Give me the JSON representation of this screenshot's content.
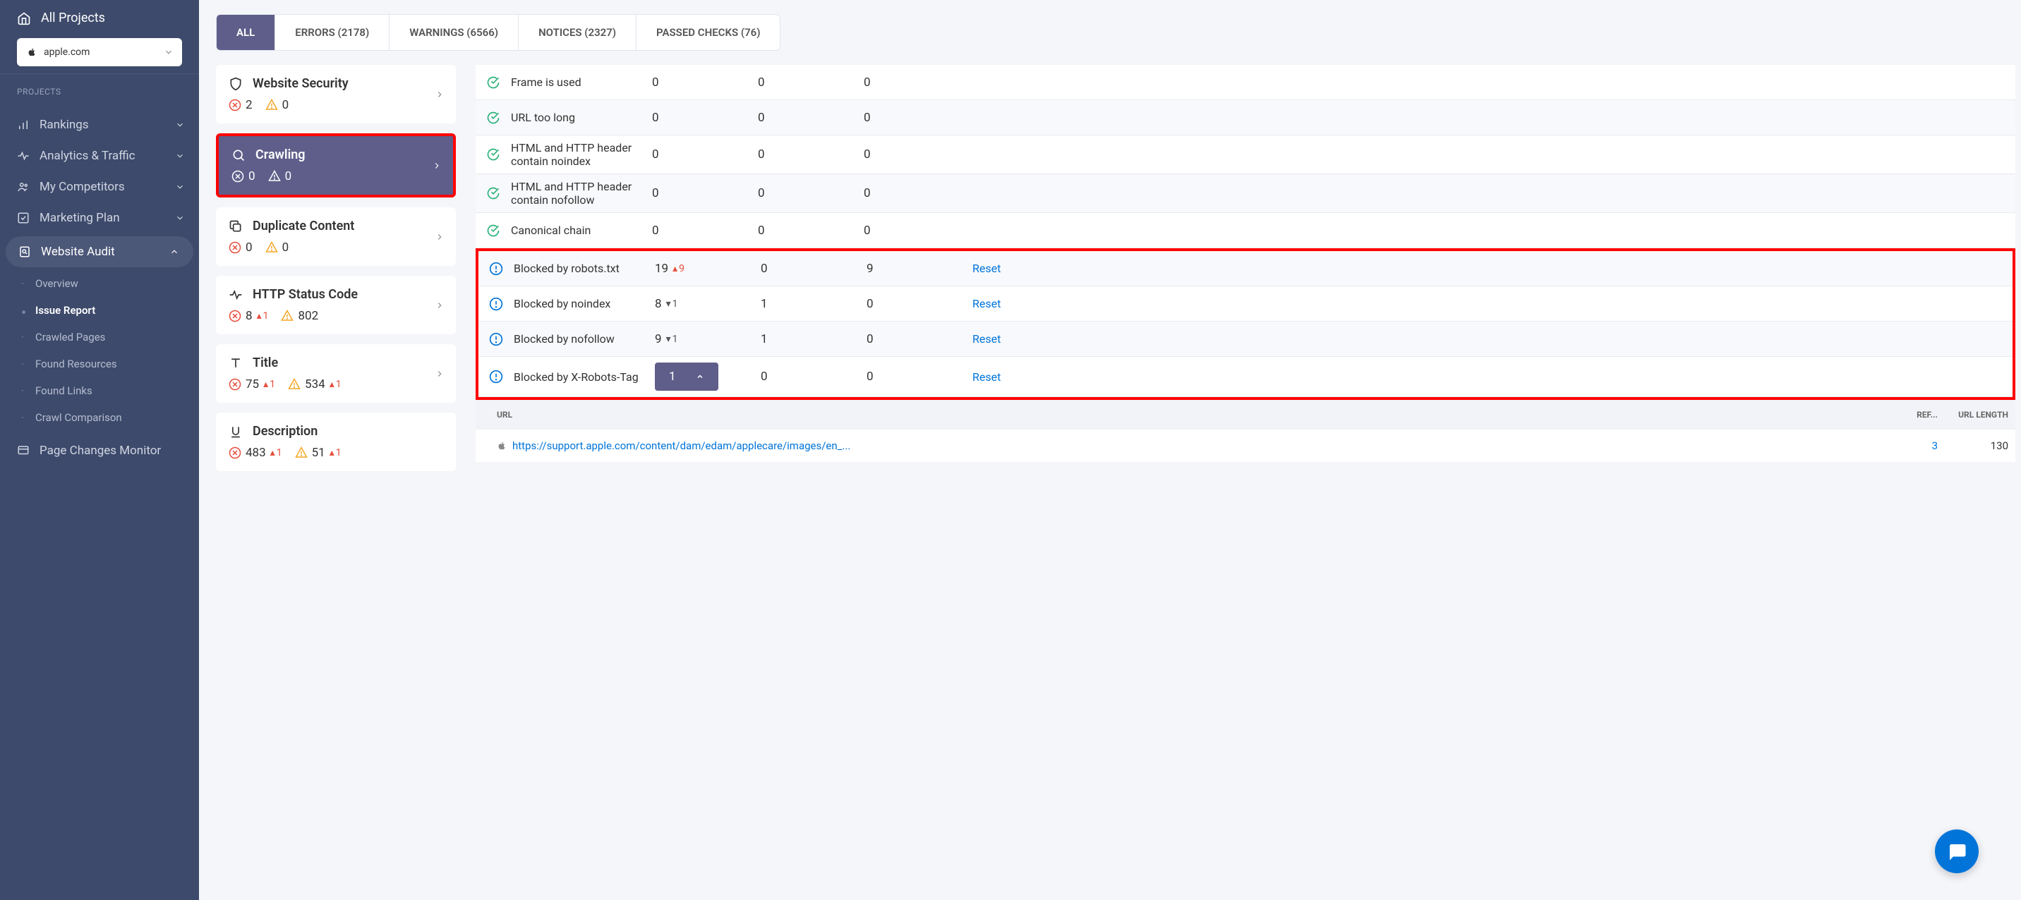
{
  "sidebar": {
    "all_projects": "All Projects",
    "site": "apple.com",
    "section_label": "PROJECTS",
    "nav": [
      {
        "label": "Rankings"
      },
      {
        "label": "Analytics & Traffic"
      },
      {
        "label": "My Competitors"
      },
      {
        "label": "Marketing Plan"
      },
      {
        "label": "Website Audit"
      }
    ],
    "sub": [
      {
        "label": "Overview"
      },
      {
        "label": "Issue Report"
      },
      {
        "label": "Crawled Pages"
      },
      {
        "label": "Found Resources"
      },
      {
        "label": "Found Links"
      },
      {
        "label": "Crawl Comparison"
      }
    ],
    "page_changes": "Page Changes Monitor"
  },
  "tabs": [
    {
      "label": "ALL"
    },
    {
      "label": "ERRORS (2178)"
    },
    {
      "label": "WARNINGS (6566)"
    },
    {
      "label": "NOTICES (2327)"
    },
    {
      "label": "PASSED CHECKS (76)"
    }
  ],
  "cats": [
    {
      "title": "Website Security",
      "err": "2",
      "warn": "0"
    },
    {
      "title": "Crawling",
      "err": "0",
      "warn": "0"
    },
    {
      "title": "Duplicate Content",
      "err": "0",
      "warn": "0"
    },
    {
      "title": "HTTP Status Code",
      "err": "8",
      "err_d": "1",
      "warn": "802"
    },
    {
      "title": "Title",
      "err": "75",
      "err_d": "1",
      "warn": "534",
      "warn_d": "1"
    },
    {
      "title": "Description",
      "err": "483",
      "err_d": "1",
      "warn": "51",
      "warn_d": "1"
    }
  ],
  "rows": [
    {
      "name": "Frame is used",
      "v1": "0",
      "v2": "0",
      "v3": "0",
      "type": "pass"
    },
    {
      "name": "URL too long",
      "v1": "0",
      "v2": "0",
      "v3": "0",
      "type": "pass"
    },
    {
      "name": "HTML and HTTP header contain noindex",
      "v1": "0",
      "v2": "0",
      "v3": "0",
      "type": "pass"
    },
    {
      "name": "HTML and HTTP header contain nofollow",
      "v1": "0",
      "v2": "0",
      "v3": "0",
      "type": "pass"
    },
    {
      "name": "Canonical chain",
      "v1": "0",
      "v2": "0",
      "v3": "0",
      "type": "pass"
    },
    {
      "name": "Blocked by robots.txt",
      "v1": "19",
      "d": "9",
      "ddir": "up",
      "v2": "0",
      "v3": "9",
      "type": "notice",
      "reset": "Reset"
    },
    {
      "name": "Blocked by noindex",
      "v1": "8",
      "d": "1",
      "ddir": "down",
      "v2": "1",
      "v3": "0",
      "type": "notice",
      "reset": "Reset"
    },
    {
      "name": "Blocked by nofollow",
      "v1": "9",
      "d": "1",
      "ddir": "down",
      "v2": "1",
      "v3": "0",
      "type": "notice",
      "reset": "Reset"
    },
    {
      "name": "Blocked by X-Robots-Tag",
      "v1": "1",
      "pill": true,
      "v2": "0",
      "v3": "0",
      "type": "notice",
      "reset": "Reset"
    }
  ],
  "hdr": {
    "url": "URL",
    "ref": "REF...",
    "len": "URL LENGTH"
  },
  "data": {
    "url": "https://support.apple.com/content/dam/edam/applecare/images/en_...",
    "ref": "3",
    "len": "130"
  }
}
